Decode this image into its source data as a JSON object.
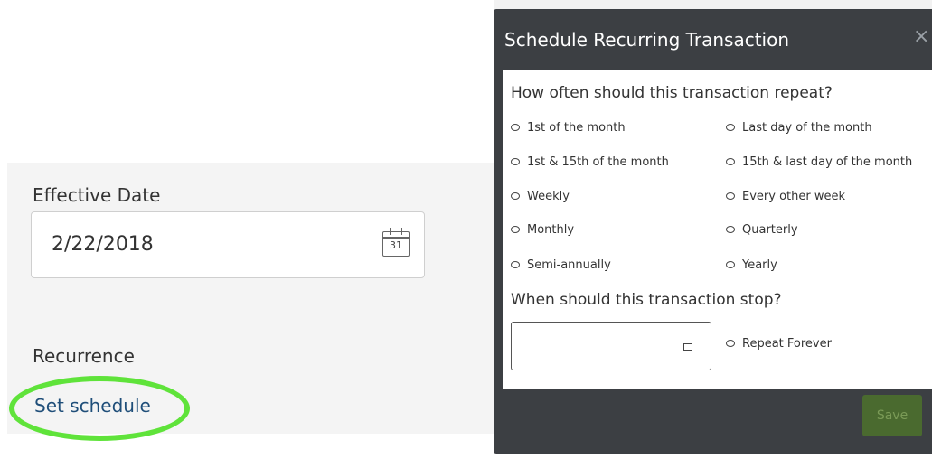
{
  "form": {
    "effective_date_label": "Effective Date",
    "effective_date_value": "2/22/2018",
    "calendar_day": "31",
    "recurrence_label": "Recurrence",
    "set_schedule_link": "Set schedule"
  },
  "modal": {
    "title": "Schedule Recurring Transaction",
    "close": "×",
    "frequency_question": "How often should this transaction repeat?",
    "frequency_options": [
      "1st of the month",
      "Last day of the month",
      "1st & 15th of the month",
      "15th & last day of the month",
      "Weekly",
      "Every other week",
      "Monthly",
      "Quarterly",
      "Semi-annually",
      "Yearly"
    ],
    "stop_question": "When should this transaction stop?",
    "stop_date_value": "",
    "repeat_forever": "Repeat Forever",
    "save_label": "Save"
  },
  "colors": {
    "modal_bg": "#3c3f43",
    "highlight": "#5fe33a",
    "link": "#1f4e79",
    "save_button": "#4a6a2f"
  }
}
